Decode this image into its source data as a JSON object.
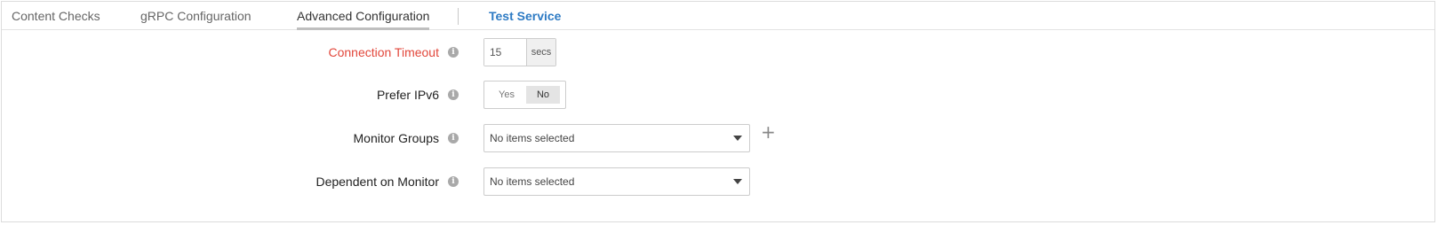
{
  "tabs": [
    {
      "label": "Content Checks"
    },
    {
      "label": "gRPC Configuration"
    },
    {
      "label": "Advanced Configuration"
    }
  ],
  "test_service_label": "Test Service",
  "form": {
    "connection_timeout": {
      "label": "Connection Timeout",
      "value": "15",
      "unit": "secs"
    },
    "prefer_ipv6": {
      "label": "Prefer IPv6",
      "yes": "Yes",
      "no": "No",
      "selected": "No"
    },
    "monitor_groups": {
      "label": "Monitor Groups",
      "value": "No items selected",
      "add_symbol": "+"
    },
    "dependent_on_monitor": {
      "label": "Dependent on Monitor",
      "value": "No items selected"
    }
  },
  "info_glyph": "i",
  "colors": {
    "error": "#e2473b",
    "link": "#2e7bc4",
    "active_underline": "#bfbfbf"
  }
}
